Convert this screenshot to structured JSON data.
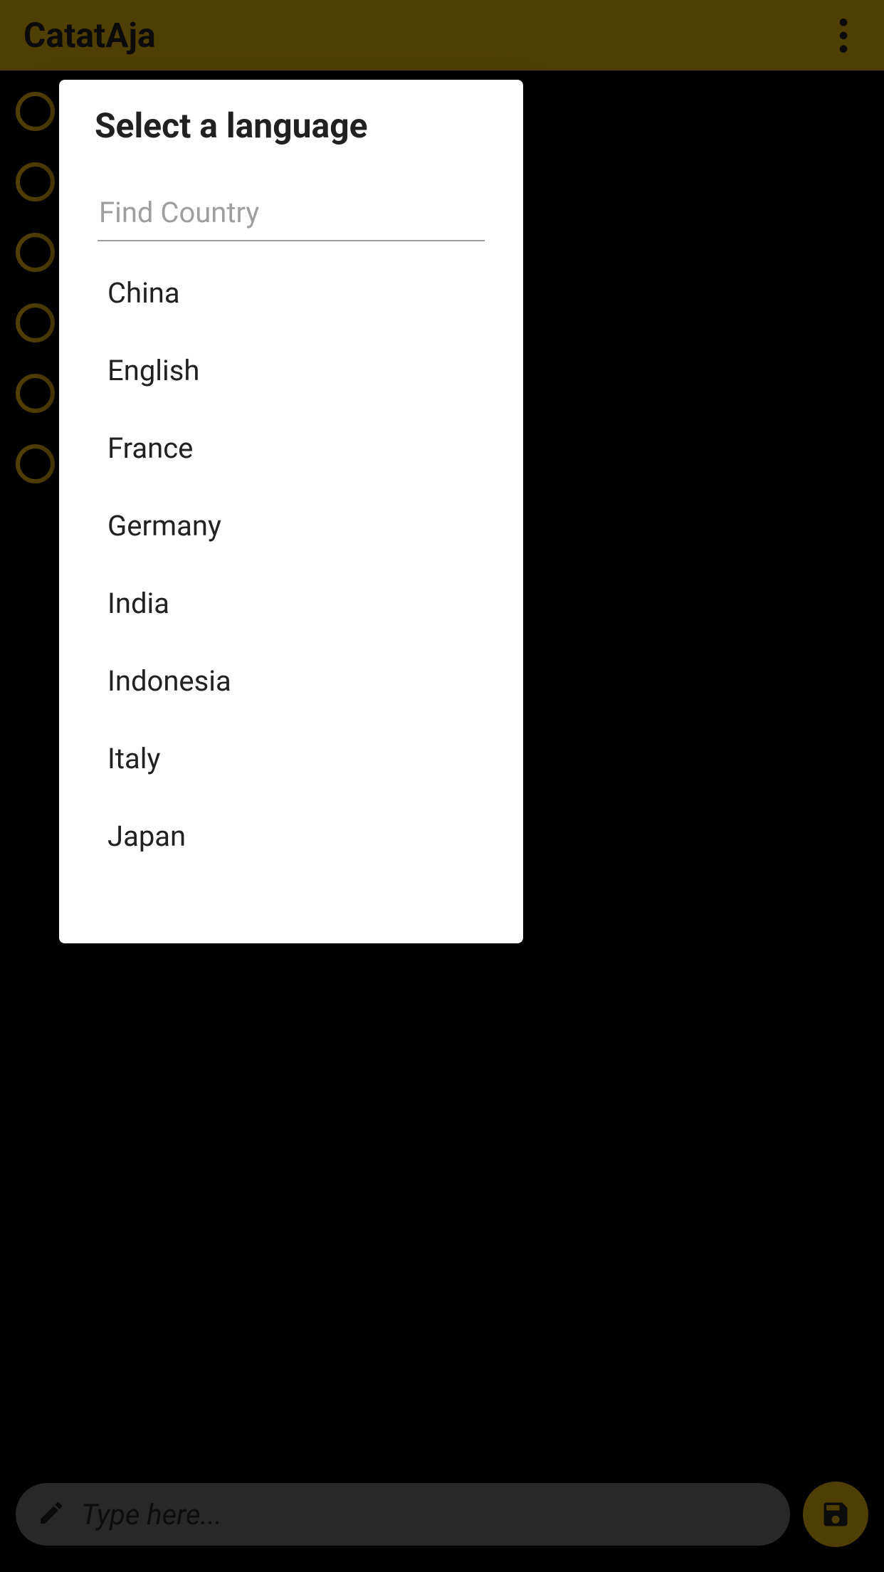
{
  "app": {
    "title": "CatatAja"
  },
  "bottom": {
    "placeholder": "Type here..."
  },
  "dialog": {
    "title": "Select a language",
    "search_placeholder": "Find Country",
    "options": [
      "China",
      "English",
      "France",
      "Germany",
      "India",
      "Indonesia",
      "Italy",
      "Japan"
    ]
  },
  "background": {
    "radio_count": 6
  },
  "icons": {
    "more": "more-vert",
    "pencil": "edit",
    "save": "save"
  },
  "colors": {
    "accent": "#b28c0a",
    "bg": "#000000",
    "dialog_bg": "#ffffff"
  }
}
